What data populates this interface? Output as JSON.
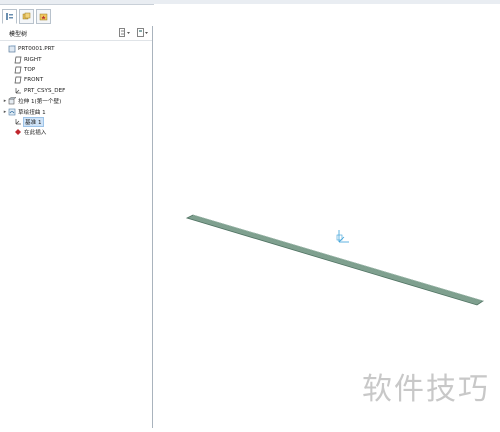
{
  "tree": {
    "title": "模型树",
    "items": [
      {
        "label": "PRT0001.PRT",
        "icon": "part-icon",
        "indent": 0,
        "expander": ""
      },
      {
        "label": "RIGHT",
        "icon": "datum-plane-icon",
        "indent": 1,
        "expander": ""
      },
      {
        "label": "TOP",
        "icon": "datum-plane-icon",
        "indent": 1,
        "expander": ""
      },
      {
        "label": "FRONT",
        "icon": "datum-plane-icon",
        "indent": 1,
        "expander": ""
      },
      {
        "label": "PRT_CSYS_DEF",
        "icon": "csys-icon",
        "indent": 1,
        "expander": ""
      },
      {
        "label": "拉伸 1(第一个壁)",
        "icon": "extrude-icon",
        "indent": 1,
        "expander": "▸"
      },
      {
        "label": "草绘扭曲 1",
        "icon": "sketch-icon",
        "indent": 1,
        "expander": "▸"
      },
      {
        "label": "基准 1",
        "icon": "csys-icon",
        "indent": 1,
        "expander": "",
        "selected": true
      },
      {
        "label": "在此插入",
        "icon": "insert-here-icon",
        "indent": 1,
        "expander": ""
      }
    ]
  },
  "watermark": "软件技巧",
  "colors": {
    "plate_fill": "#7fa08f",
    "plate_edge": "#4f7262",
    "csys": "#3aa0d8",
    "selection": "#cfe3f7"
  }
}
